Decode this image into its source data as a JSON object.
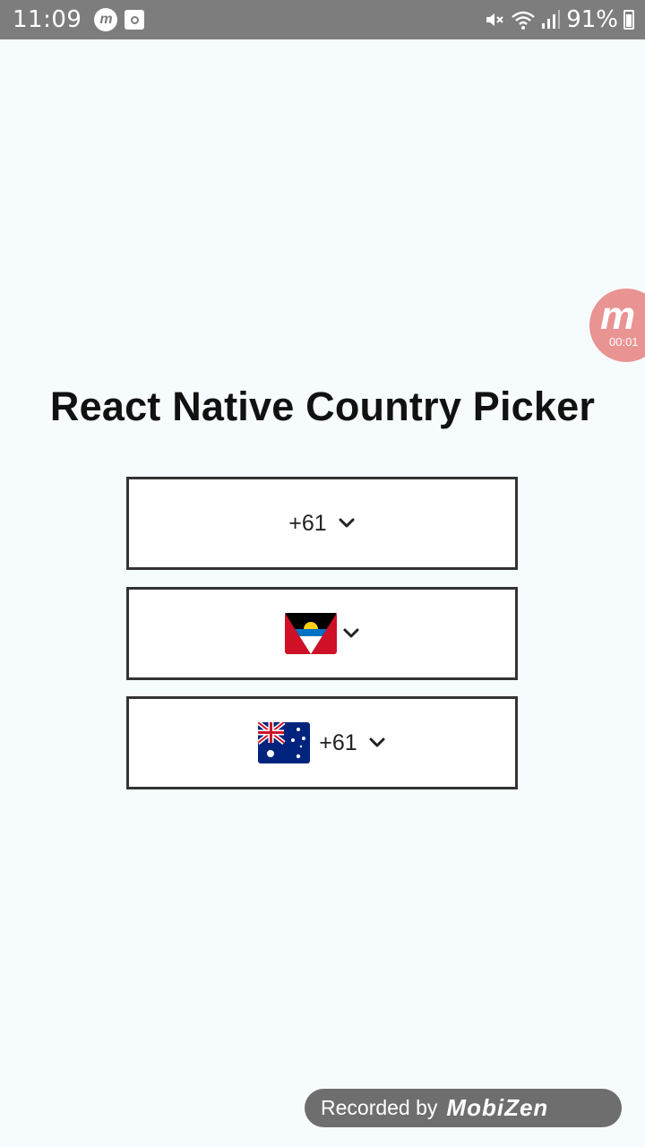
{
  "status_bar": {
    "time": "11:09",
    "battery": "91%",
    "icons": [
      "mobizen-notification-icon",
      "screen-record-icon",
      "mute-icon",
      "wifi-icon",
      "signal-icon",
      "battery-icon"
    ]
  },
  "header": {
    "title": "React Native Country Picker"
  },
  "pickers": [
    {
      "calling_code": "+61",
      "flag": null,
      "icon": "chevron-down-icon"
    },
    {
      "calling_code": null,
      "flag": "antigua-and-barbuda-flag-icon",
      "icon": "chevron-down-icon"
    },
    {
      "calling_code": "+61",
      "flag": "australia-flag-icon",
      "icon": "chevron-down-icon"
    }
  ],
  "overlay": {
    "mobizen_letter": "m",
    "timer": "00:01",
    "recorded_by": "Recorded by",
    "brand": "MobiZen"
  },
  "colors": {
    "background": "#f6fbfe",
    "status_bar": "#7d7d7d",
    "picker_border": "#333333",
    "mobizen_float": "#e98b8b"
  }
}
